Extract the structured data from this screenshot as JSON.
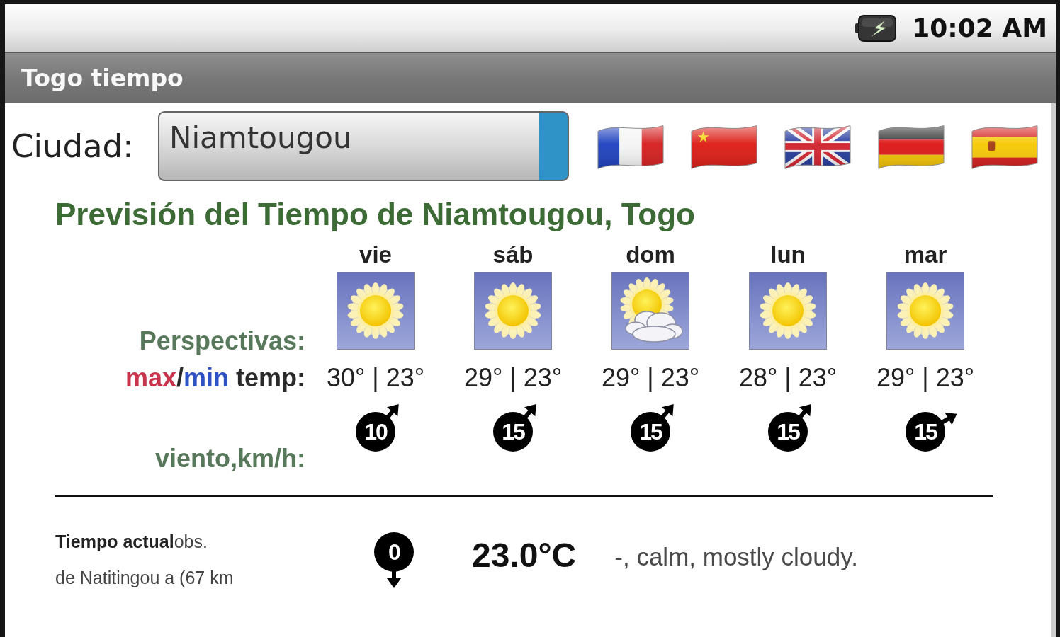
{
  "status_bar": {
    "time": "10:02 AM"
  },
  "app_bar": {
    "title": "Togo tiempo"
  },
  "city_picker": {
    "label": "Ciudad:",
    "value": "Niamtougou"
  },
  "language_flags": [
    {
      "kind": "france"
    },
    {
      "kind": "china"
    },
    {
      "kind": "uk"
    },
    {
      "kind": "germany"
    },
    {
      "kind": "spain"
    }
  ],
  "forecast": {
    "title": "Previsión del Tiempo de Niamtougou, Togo",
    "outlook_label": "Perspectivas:",
    "temp_label": [
      {
        "text": "max",
        "kind": "max"
      },
      {
        "text": "/",
        "kind": "plain"
      },
      {
        "text": "min",
        "kind": "min"
      },
      {
        "text": " temp:",
        "kind": "plain"
      }
    ],
    "wind_label": "viento,km/h:",
    "days": [
      {
        "day": "vie",
        "kind": "sunny",
        "temps": "30° | 23°",
        "wind": {
          "speed": "10",
          "kind": "ne"
        }
      },
      {
        "day": "sáb",
        "kind": "sunny",
        "temps": "29° | 23°",
        "wind": {
          "speed": "15",
          "kind": "ne"
        }
      },
      {
        "day": "dom",
        "kind": "partly_cloudy",
        "temps": "29° | 23°",
        "wind": {
          "speed": "15",
          "kind": "ne"
        }
      },
      {
        "day": "lun",
        "kind": "sunny",
        "temps": "28° | 23°",
        "wind": {
          "speed": "15",
          "kind": "ne"
        }
      },
      {
        "day": "mar",
        "kind": "sunny",
        "temps": "29° | 23°",
        "wind": {
          "speed": "15",
          "kind": "ene"
        }
      }
    ]
  },
  "current": {
    "title": "**Tiempo actual**obs.",
    "station": "de Natitingou a (67 km",
    "wind": {
      "speed": "0",
      "kind": "s"
    },
    "temperature": "23.0°C",
    "conditions": "-, calm, mostly cloudy."
  }
}
